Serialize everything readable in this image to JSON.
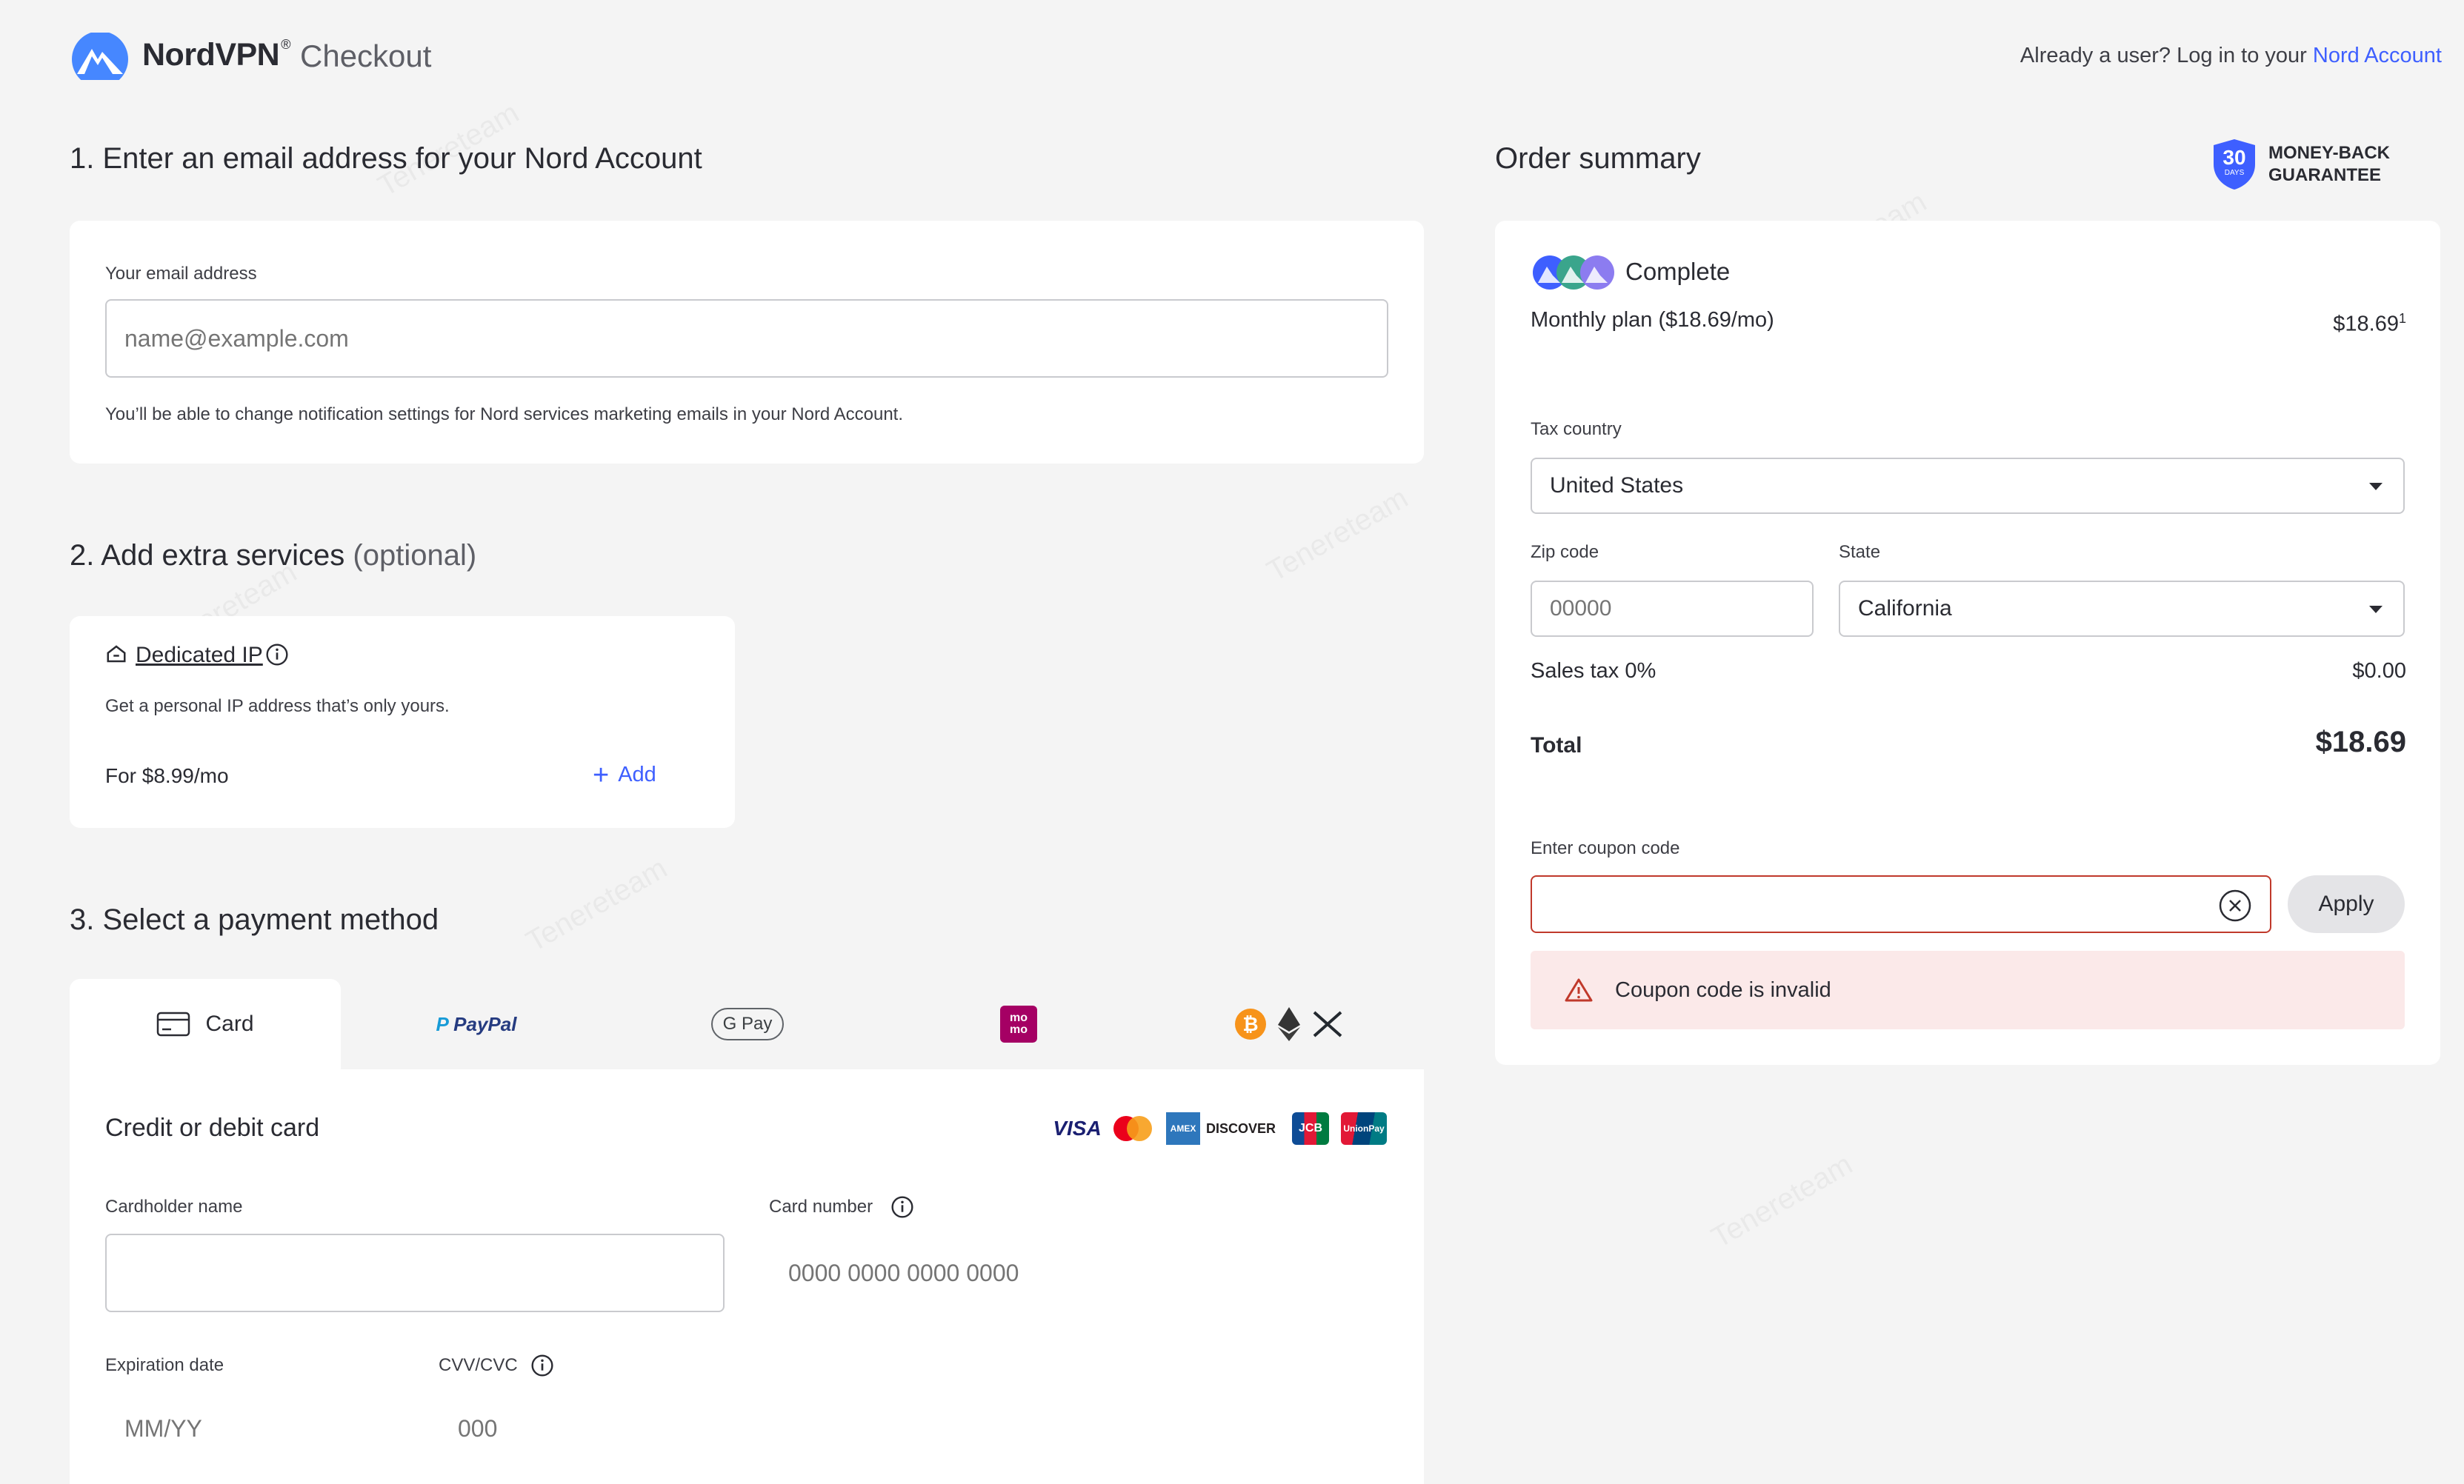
{
  "header": {
    "brand": "NordVPN",
    "brand_mark": "®",
    "subtitle": "Checkout",
    "login_prefix": "Already a user? Log in to your ",
    "login_link": "Nord Account"
  },
  "watermark": "Tenereteam",
  "email_section": {
    "title": "1. Enter an email address for your Nord Account",
    "label": "Your email address",
    "placeholder": "name@example.com",
    "note": "You’ll be able to change notification settings for Nord services marketing emails in your Nord Account."
  },
  "extras_section": {
    "title": "2. Add extra services",
    "optional": "(optional)",
    "service": {
      "name": "Dedicated IP",
      "description": "Get a personal IP address that’s only yours.",
      "price": "For $8.99/mo",
      "add_label": "Add"
    }
  },
  "payment_section": {
    "title": "3. Select a payment method",
    "tabs": [
      {
        "label": "Card",
        "icon": "credit-card-icon"
      },
      {
        "label": "PayPal",
        "icon": "paypal-logo"
      },
      {
        "label": "G Pay",
        "icon": "google-pay-logo"
      },
      {
        "label": "mo mo",
        "icon": "momo-logo"
      },
      {
        "label": "",
        "icon": "crypto-icons"
      }
    ],
    "card_title": "Credit or debit card",
    "card_brands": [
      "VISA",
      "Mastercard",
      "AMEX",
      "DISCOVER",
      "JCB",
      "UnionPay"
    ],
    "cardholder_label": "Cardholder name",
    "card_number_label": "Card number",
    "card_number_placeholder": "0000 0000 0000 0000",
    "expiry_label": "Expiration date",
    "expiry_placeholder": "MM/YY",
    "cvv_label": "CVV/CVC",
    "cvv_placeholder": "000"
  },
  "order_summary": {
    "title": "Order summary",
    "badge_days": "30",
    "badge_days_label": "DAYS",
    "guarantee_line1": "MONEY-BACK",
    "guarantee_line2": "GUARANTEE",
    "plan_name": "Complete",
    "plan_desc": "Monthly plan ($18.69/mo)",
    "plan_price": "$18.69",
    "plan_footnote": "1",
    "tax_country_label": "Tax country",
    "tax_country_value": "United States",
    "zip_label": "Zip code",
    "zip_placeholder": "00000",
    "state_label": "State",
    "state_value": "California",
    "sales_tax_label": "Sales tax 0%",
    "sales_tax_value": "$0.00",
    "total_label": "Total",
    "total_value": "$18.69",
    "coupon_label": "Enter coupon code",
    "coupon_value": "",
    "apply_label": "Apply",
    "error_message": "Coupon code is invalid"
  },
  "colors": {
    "accent": "#3e5fff",
    "error": "#c0392b",
    "error_bg": "#fbe9e9",
    "background": "#f4f4f4"
  }
}
